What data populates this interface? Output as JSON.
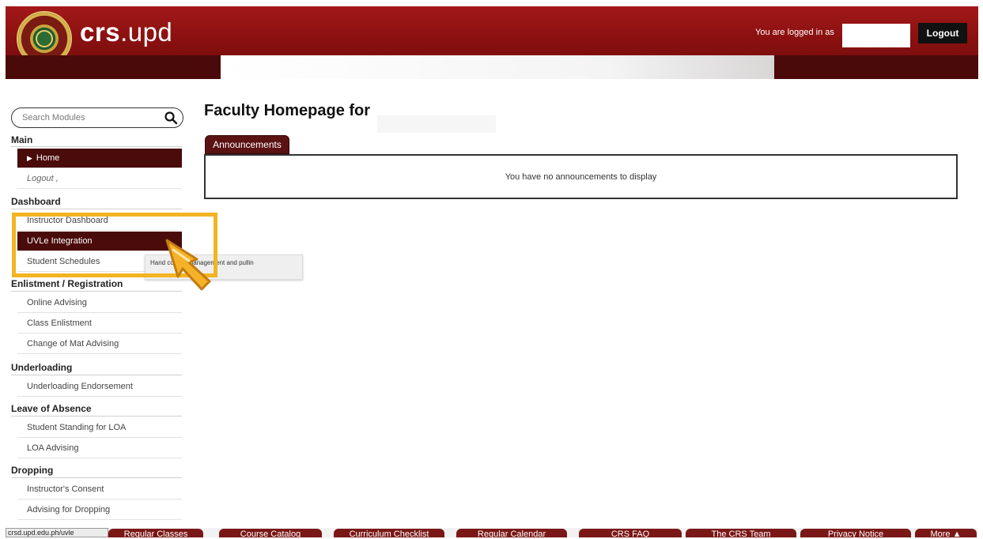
{
  "header": {
    "brand_bold": "crs",
    "brand_rest": ".upd",
    "logged_in_text": "You are logged in as",
    "logout_label": "Logout"
  },
  "sidebar": {
    "search_placeholder": "Search Modules",
    "sections": {
      "main": "Main",
      "dashboard": "Dashboard",
      "enlistment": "Enlistment / Registration",
      "underloading": "Underloading",
      "loa": "Leave of Absence",
      "dropping": "Dropping"
    },
    "items": {
      "home": "Home",
      "logout": "Logout ,",
      "instructor_dashboard": "Instructor Dashboard",
      "uvle_integration": "UVLe Integration",
      "student_schedules": "Student Schedules",
      "online_advising": "Online Advising",
      "class_enlistment": "Class Enlistment",
      "change_of_mat": "Change of Mat Advising",
      "underloading_endorsement": "Underloading Endorsement",
      "student_standing_loa": "Student Standing for LOA",
      "loa_advising": "LOA Advising",
      "instructors_consent": "Instructor's Consent",
      "advising_dropping": "Advising for Dropping"
    }
  },
  "tooltip": {
    "text": "Hand course management and pullin"
  },
  "main": {
    "page_title": "Faculty Homepage for",
    "tab_label": "Announcements",
    "empty_message": "You have no announcements to display"
  },
  "footer": {
    "status_url": "crsd.upd.edu.ph/uvle",
    "tabs": [
      "Regular Classes",
      "Course Catalog",
      "Curriculum Checklist",
      "Regular Calendar",
      "CRS FAQ",
      "The CRS Team",
      "Privacy Notice",
      "More ▲"
    ]
  },
  "colors": {
    "header_red": "#a31919",
    "dark_maroon": "#4a0b0b",
    "highlight": "#f4b421"
  }
}
